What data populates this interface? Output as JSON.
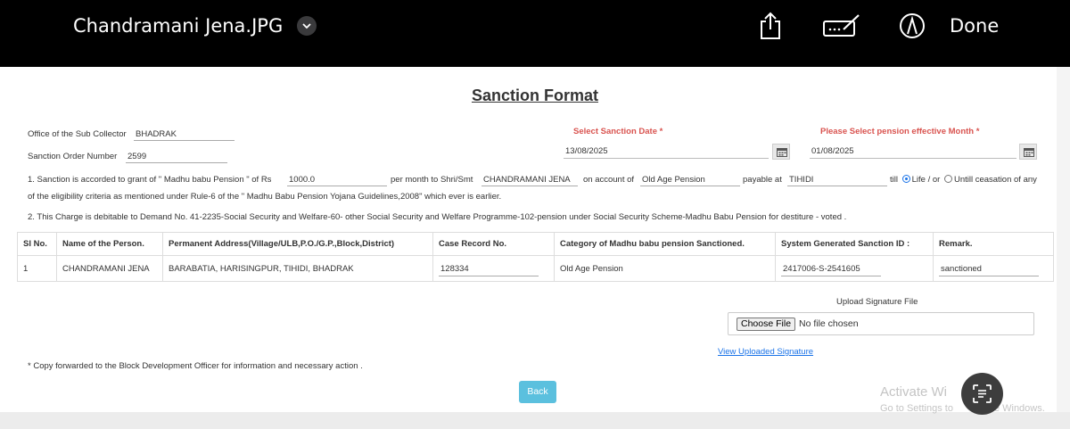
{
  "viewer": {
    "file_title": "Chandramani Jena.JPG",
    "done_label": "Done",
    "icons": [
      "chevron-down-icon",
      "share-icon",
      "signature-icon",
      "markup-icon"
    ]
  },
  "form": {
    "title": "Sanction Format",
    "office_label": "Office of the Sub Collector",
    "office_value": "BHADRAK",
    "order_label": "Sanction Order Number",
    "order_value": "2599",
    "sanction_date_label": "Select Sanction Date *",
    "sanction_date_value": "13/08/2025",
    "effective_month_label": "Please Select pension effective Month *",
    "effective_month_value": "01/08/2025",
    "para1": {
      "t1": "1. Sanction is accorded to grant of \" Madhu babu Pension \" of Rs",
      "amount": "1000.0",
      "t2": "per month to Shri/Smt",
      "name": "CHANDRAMANI JENA",
      "t3": "on account of",
      "category": "Old Age Pension",
      "t4": "payable at",
      "place": "TIHIDI",
      "t5": "till",
      "opt_life": "Life / or",
      "opt_until": "Untill ceasation of any",
      "line2": "of the eligibility criteria as mentioned under Rule-6 of the \" Madhu Babu Pension Yojana Guidelines,2008\" which ever is earlier."
    },
    "para2": "2. This Charge is debitable to Demand No. 41-2235-Social Security and Welfare-60- other Social Security and Welfare Programme-102-pension under Social Security Scheme-Madhu Babu Pension for destiture - voted .",
    "table": {
      "headers": [
        "Sl No.",
        "Name of the Person.",
        "Permanent Address(Village/ULB,P.O./G.P.,Block,District)",
        "Case Record No.",
        "Category of Madhu babu pension Sanctioned.",
        "System Generated Sanction ID :",
        "Remark."
      ],
      "row": {
        "sl": "1",
        "name": "CHANDRAMANI JENA",
        "address": "BARABATIA, HARISINGPUR, TIHIDI, BHADRAK",
        "case_record": "128334",
        "category": "Old Age Pension",
        "sanction_id": "2417006-S-2541605",
        "remark": "sanctioned"
      }
    },
    "upload_label": "Upload Signature File",
    "choose_file": "Choose File",
    "no_file": "No file chosen",
    "view_signature": "View Uploaded Signature",
    "copy_forwarded": "* Copy forwarded to the Block Development Officer for information and necessary action .",
    "back_label": "Back"
  },
  "watermark": {
    "line1": "Activate Wi",
    "line2": "Go to Settings to",
    "line2b": "e Windows."
  },
  "colors": {
    "bar": "#000000",
    "required_label": "#d9534f",
    "link": "#1a73e8",
    "back_button": "#5bc0de"
  }
}
